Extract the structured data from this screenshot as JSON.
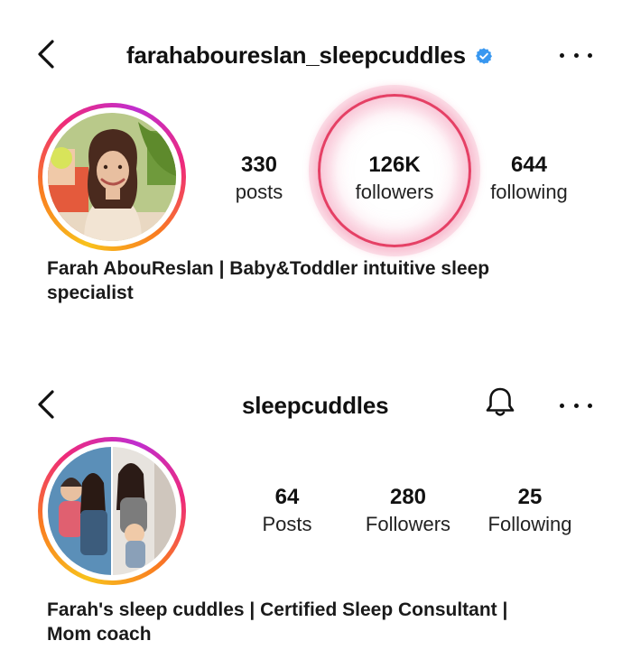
{
  "profile_1": {
    "username": "farahaboureslan_sleepcuddles",
    "verified": true,
    "stats": {
      "posts": {
        "value": "330",
        "label": "posts"
      },
      "followers": {
        "value": "126K",
        "label": "followers"
      },
      "following": {
        "value": "644",
        "label": "following"
      }
    },
    "bio_line_1": "Farah AbouReslan | Baby&Toddler intuitive sleep",
    "bio_line_2": "specialist"
  },
  "profile_2": {
    "username": "sleepcuddles",
    "stats": {
      "posts": {
        "value": "64",
        "label": "Posts"
      },
      "followers": {
        "value": "280",
        "label": "Followers"
      },
      "following": {
        "value": "25",
        "label": "Following"
      }
    },
    "bio_line_1": "Farah's sleep cuddles | Certified Sleep Consultant |",
    "bio_line_2": "Mom coach"
  },
  "icons": {
    "back": "chevron-left-icon",
    "verified": "verified-badge-icon",
    "more": "more-horizontal-icon",
    "notification": "bell-icon"
  },
  "colors": {
    "verified_blue": "#3897f0",
    "highlight_red": "#e0204a",
    "ring_gradient": [
      "#f8c21c",
      "#f97b21",
      "#ee2a7b",
      "#c02ecf"
    ]
  }
}
